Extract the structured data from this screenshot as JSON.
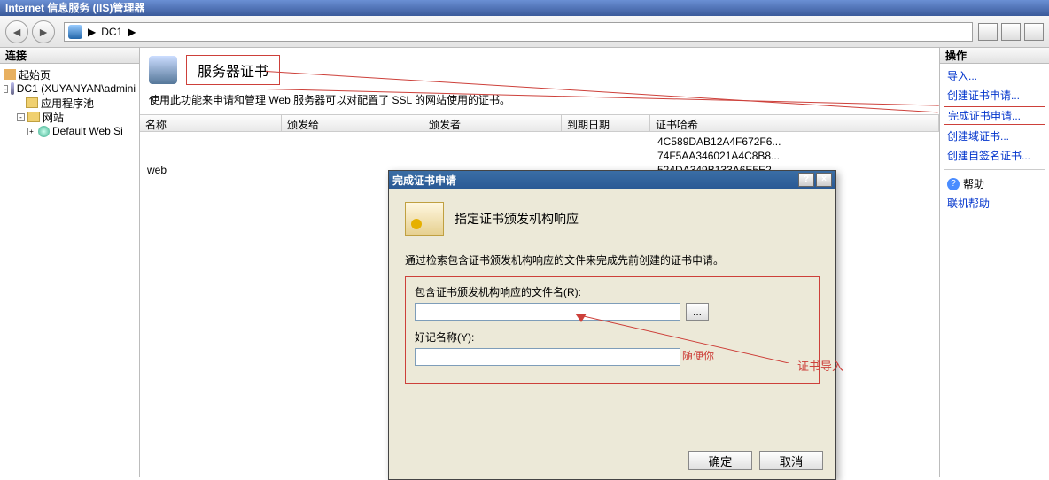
{
  "window": {
    "title": "Internet 信息服务 (IIS)管理器"
  },
  "breadcrumb": {
    "root": "DC1",
    "sep": "▶"
  },
  "left_panel": {
    "title": "连接"
  },
  "tree": {
    "start_page": "起始页",
    "server": "DC1 (XUYANYAN\\admini",
    "app_pools": "应用程序池",
    "sites": "网站",
    "default_site": "Default Web Si"
  },
  "page": {
    "title": "服务器证书",
    "description": "使用此功能来申请和管理 Web 服务器可以对配置了 SSL 的网站使用的证书。"
  },
  "columns": {
    "name": "名称",
    "issued_to": "颁发给",
    "issued_by": "颁发者",
    "expires": "到期日期",
    "hash": "证书哈希"
  },
  "certs": [
    {
      "name": "",
      "hash": "4C589DAB12A4F672F6..."
    },
    {
      "name": "",
      "hash": "74F5AA346021A4C8B8..."
    },
    {
      "name": "web",
      "hash": "524DA349B133A6E5E2..."
    }
  ],
  "actions": {
    "title": "操作",
    "import": "导入...",
    "create_request": "创建证书申请...",
    "complete_request": "完成证书申请...",
    "create_domain": "创建域证书...",
    "create_self": "创建自签名证书...",
    "help": "帮助",
    "online_help": "联机帮助"
  },
  "dialog": {
    "title": "完成证书申请",
    "heading": "指定证书颁发机构响应",
    "desc": "通过检索包含证书颁发机构响应的文件来完成先前创建的证书申请。",
    "file_label": "包含证书颁发机构响应的文件名(R):",
    "friendly_label": "好记名称(Y):",
    "file_value": "",
    "friendly_value": "",
    "browse": "...",
    "note": "随便你",
    "ok": "确定",
    "cancel": "取消",
    "help_mark": "?",
    "close_mark": "×"
  },
  "annotations": {
    "import_label": "证书导入"
  }
}
